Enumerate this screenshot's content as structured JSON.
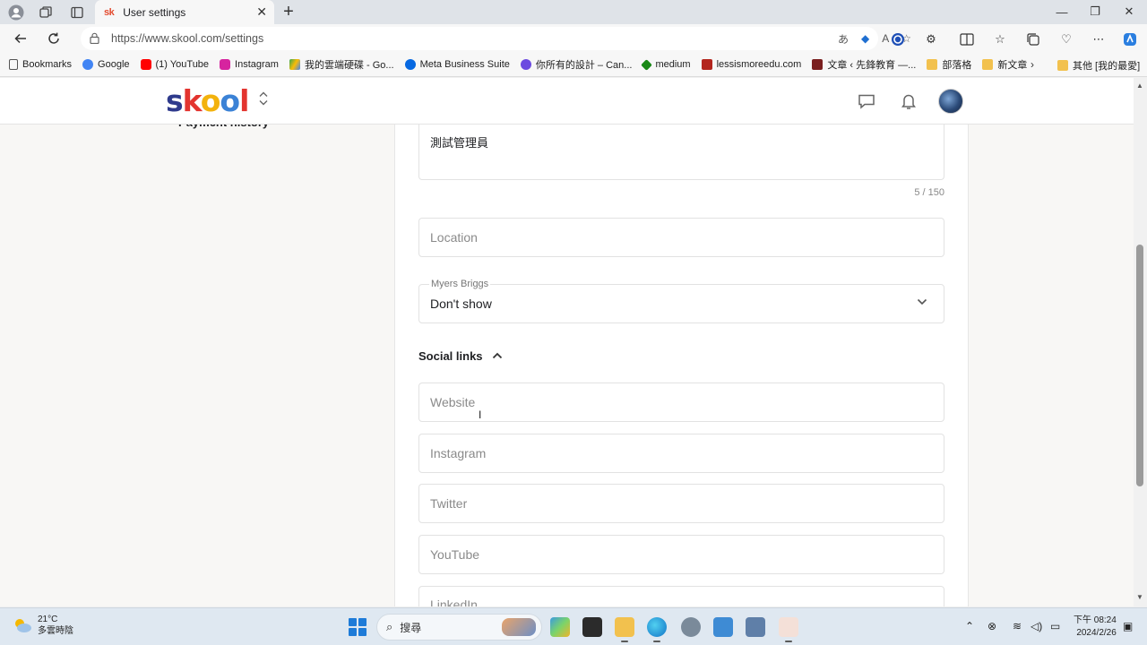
{
  "browser": {
    "tab_title": "User settings",
    "tab_favicon": "sk",
    "url": "https://www.skool.com/settings",
    "bookmarks": [
      {
        "label": "Bookmarks",
        "icon": "bookmark-icon",
        "color": "#555555"
      },
      {
        "label": "Google",
        "icon": "google-icon",
        "color": "#4285f4"
      },
      {
        "label": "(1) YouTube",
        "icon": "youtube-icon",
        "color": "#ff0000"
      },
      {
        "label": "Instagram",
        "icon": "instagram-icon",
        "color": "#d6249f"
      },
      {
        "label": "我的雲端硬碟 - Go...",
        "icon": "drive-icon",
        "color": "#34a853"
      },
      {
        "label": "Meta Business Suite",
        "icon": "meta-icon",
        "color": "#0668e1"
      },
      {
        "label": "你所有的設計 – Can...",
        "icon": "canva-icon",
        "color": "#00c4cc"
      },
      {
        "label": "medium",
        "icon": "medium-icon",
        "color": "#1a8917"
      },
      {
        "label": "lessismoreedu.com",
        "icon": "site-icon",
        "color": "#b3261e"
      },
      {
        "label": "文章 ‹ 先鋒教育 —...",
        "icon": "site-icon",
        "color": "#7a1f1f"
      },
      {
        "label": "部落格",
        "icon": "folder-icon",
        "color": "#f2c14e"
      },
      {
        "label": "新文章",
        "icon": "folder-icon",
        "color": "#f2c14e"
      }
    ],
    "other_bookmarks": "其他 [我的最愛]"
  },
  "site": {
    "logo": [
      "s",
      "k",
      "o",
      "o",
      "l"
    ],
    "logo_colors": [
      "#2e3a8c",
      "#e3342f",
      "#f3b20d",
      "#3b82d6",
      "#e3342f"
    ]
  },
  "sidebar": {
    "partial_item": "Payment history"
  },
  "form": {
    "bio_value": "測試管理員",
    "bio_counter": "5 / 150",
    "location_placeholder": "Location",
    "myers_briggs_label": "Myers Briggs",
    "myers_briggs_value": "Don't show",
    "social_links_title": "Social links",
    "website_placeholder": "Website",
    "instagram_placeholder": "Instagram",
    "twitter_placeholder": "Twitter",
    "youtube_placeholder": "YouTube",
    "linkedin_placeholder": "LinkedIn"
  },
  "taskbar": {
    "temperature": "21°C",
    "weather_desc": "多雲時陰",
    "search_placeholder": "搜尋",
    "time": "下午 08:24",
    "date": "2024/2/26"
  }
}
